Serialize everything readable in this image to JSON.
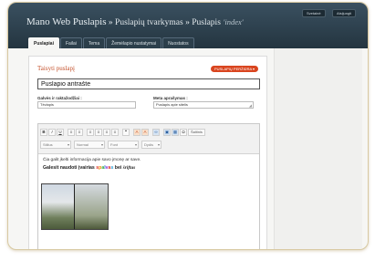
{
  "header": {
    "site_name": "Mano Web Puslapis",
    "sep1": " » ",
    "crumb1": "Puslapių tvarkymas",
    "sep2": " » ",
    "crumb2": "Puslapis",
    "template": "'index'",
    "visit_label": "Svetainė",
    "logout_label": "Atsijungti"
  },
  "tabs": [
    "Puslapiai",
    "Failai",
    "Tema",
    "Žemėlapio nustatymai",
    "Nuostatos"
  ],
  "panel": {
    "title": "Taisyti puslapį",
    "preview_label": "PUSLAPIŲ PERŽIŪRA ▾",
    "page_title_value": "Puslapio antraštė",
    "keywords_label": "Galvės ir raktažodžiai :",
    "keywords_value": "Tėvlapis",
    "meta_label": "Meta aprašymas :",
    "meta_value": "Puslapis apie sitelis"
  },
  "editor": {
    "toolbar_row1": [
      {
        "icon": "bold-icon",
        "glyph": "B"
      },
      {
        "icon": "italic-icon",
        "glyph": "I"
      },
      {
        "icon": "underline-icon",
        "glyph": "U"
      },
      {
        "icon": "bullet-list-icon",
        "glyph": "≡"
      },
      {
        "icon": "numbered-list-icon",
        "glyph": "≡"
      },
      {
        "icon": "align-left-icon",
        "glyph": "≡"
      },
      {
        "icon": "align-center-icon",
        "glyph": "≡"
      },
      {
        "icon": "align-right-icon",
        "glyph": "≡"
      },
      {
        "icon": "align-justify-icon",
        "glyph": "≡"
      },
      {
        "icon": "blockquote-icon",
        "glyph": "❝"
      },
      {
        "icon": "text-color-icon",
        "glyph": "A"
      },
      {
        "icon": "background-color-icon",
        "glyph": "A"
      },
      {
        "icon": "link-icon",
        "glyph": "∞"
      },
      {
        "icon": "image-icon",
        "glyph": "▣"
      },
      {
        "icon": "table-icon",
        "glyph": "▦"
      },
      {
        "icon": "special-char-icon",
        "glyph": "Ω"
      }
    ],
    "source_label": "Šaltinis",
    "selects": {
      "style": "Stilius",
      "format": "Normal",
      "font": "Font",
      "size": "Dydis"
    },
    "content_line1": "Čia galit įkelti informacija apie savo įmonę ar save.",
    "content_line2_parts": [
      {
        "text": "Galesit naudoti įvairias ",
        "color": "#222222"
      },
      {
        "text": "s",
        "color": "#e0322b"
      },
      {
        "text": "p",
        "color": "#f08a00"
      },
      {
        "text": "a",
        "color": "#2fa83a"
      },
      {
        "text": "l",
        "color": "#2b6fd6"
      },
      {
        "text": "v",
        "color": "#8a2bd6"
      },
      {
        "text": "a",
        "color": "#e0322b"
      },
      {
        "text": "s",
        "color": "#2b9fd6"
      },
      {
        "text": " bei ",
        "color": "#222222"
      },
      {
        "text": "šriftus",
        "color": "#222222"
      }
    ],
    "image_name": "castle-photo"
  }
}
